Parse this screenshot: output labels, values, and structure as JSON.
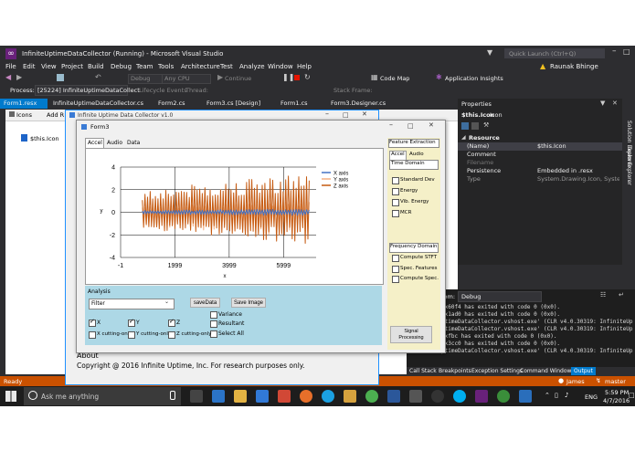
{
  "vs": {
    "title": "InfiniteUptimeDataCollector (Running) - Microsoft Visual Studio",
    "quick_launch": "Quick Launch (Ctrl+Q)",
    "user": "Raunak Bhinge",
    "menu": [
      "File",
      "Edit",
      "View",
      "Project",
      "Build",
      "Debug",
      "Team",
      "Tools",
      "Architecture",
      "Test",
      "Analyze",
      "Window",
      "Help"
    ],
    "toolbar": {
      "config": "Debug",
      "platform": "Any CPU",
      "continue": "Continue",
      "code_map": "Code Map",
      "app_insights": "Application Insights"
    },
    "process_bar": {
      "label": "Process:",
      "process": "[25224] InfiniteUptimeDataCollect",
      "lifecycle": "Lifecycle Events",
      "thread": "Thread:",
      "stack_frame": "Stack Frame:"
    },
    "tabs": [
      "Form1.resx",
      "InfiniteUptimeDataCollector.cs",
      "Form2.cs",
      "Form3.cs [Design]",
      "Form1.cs",
      "Form3.Designer.cs"
    ],
    "resource_toolbar": {
      "icons": "Icons",
      "add": "Add R"
    },
    "resource_item": "$this.Icon",
    "side_tabs": [
      "Solution Explorer",
      "Team Explorer"
    ],
    "properties": {
      "header": "Properties",
      "subject": "$this.Icon",
      "subject_type": "Icon",
      "category": "Resource",
      "rows": [
        {
          "name": "(Name)",
          "value": "$this.Icon"
        },
        {
          "name": "Comment",
          "value": ""
        },
        {
          "name": "Filename",
          "value": ""
        },
        {
          "name": "Persistence",
          "value": "Embedded in .resx"
        },
        {
          "name": "Type",
          "value": "System.Drawing.Icon, System.Dra"
        }
      ]
    },
    "output": {
      "from_label": "rom:",
      "from_value": "Debug",
      "lines": [
        "0x60f4 has exited with code 0 (0x0).",
        "0x1ad0 has exited with code 0 (0x0).",
        "ptimeDataCollector.vshost.exe' (CLR v4.0.30319: InfiniteUp",
        "ptimeDataCollector.vshost.exe' (CLR v4.0.30319: InfiniteUp",
        "0xfbc has exited with code 0 (0x0).",
        "0x3cc0 has exited with code 0 (0x0).",
        "ptimeDataCollector.vshost.exe' (CLR v4.0.30319: InfiniteUp"
      ],
      "tabs": [
        "Call Stack",
        "Breakpoints",
        "Exception Settings",
        "Command Window",
        "Output"
      ]
    },
    "status": {
      "left": "Ready",
      "user": "James",
      "branch": "master"
    }
  },
  "taskbar": {
    "search": "Ask me anything",
    "lang": "ENG",
    "time": "5:59 PM",
    "date": "4/7/2016"
  },
  "app_window": {
    "title": "Infinite Uptime Data Collector v1.0",
    "about_title": "About",
    "about_text": "Copyright @ 2016 Infinite Uptime, Inc. For research purposes only."
  },
  "form3": {
    "title": "Form3",
    "tabs": [
      "Accel",
      "Audio",
      "Data"
    ],
    "analysis": {
      "label": "Analysis",
      "filter_value": "Filter",
      "save_data": "saveData",
      "save_image": "Save Image",
      "options": [
        {
          "label": "Variance",
          "checked": false
        },
        {
          "label": "Resultant",
          "checked": false
        },
        {
          "label": "Select All",
          "checked": false
        }
      ],
      "axes": [
        {
          "label": "X",
          "checked": true
        },
        {
          "label": "Y",
          "checked": true
        },
        {
          "label": "Z",
          "checked": true
        }
      ],
      "cutting": [
        {
          "label": "X cutting-only",
          "checked": false
        },
        {
          "label": "Y cutting-only",
          "checked": false
        },
        {
          "label": "Z cutting-only",
          "checked": false
        }
      ]
    },
    "feature_extraction": {
      "title": "Feature Extraction",
      "tabs": [
        "Accel",
        "Audio"
      ],
      "time_domain": {
        "title": "Time Domain",
        "items": [
          "Standard Dev",
          "Energy",
          "Vib. Energy",
          "MCR"
        ]
      },
      "frequency_domain": {
        "title": "Frequency Domain",
        "items": [
          "Compute STFT",
          "Spec. Features",
          "Compute Spec."
        ]
      },
      "button": "Signal Processing"
    }
  },
  "chart_data": {
    "type": "line",
    "xlabel": "x",
    "ylabel": "y",
    "xlim": [
      -1,
      7200
    ],
    "ylim": [
      -4,
      4
    ],
    "x_ticks": [
      "-1",
      "1999",
      "3999",
      "5999"
    ],
    "y_ticks": [
      "4",
      "2",
      "0",
      "-2",
      "-4"
    ],
    "legend_position": "top-right",
    "series": [
      {
        "name": "X axis",
        "color": "#4472c4",
        "band_min": -0.3,
        "band_max": 0.3
      },
      {
        "name": "Y axis",
        "color": "#f4b183",
        "band_min": -2.2,
        "band_max": 1.0
      },
      {
        "name": "Z axis",
        "color": "#c55a11",
        "band_min": -2.8,
        "band_max": 3.6
      }
    ]
  }
}
